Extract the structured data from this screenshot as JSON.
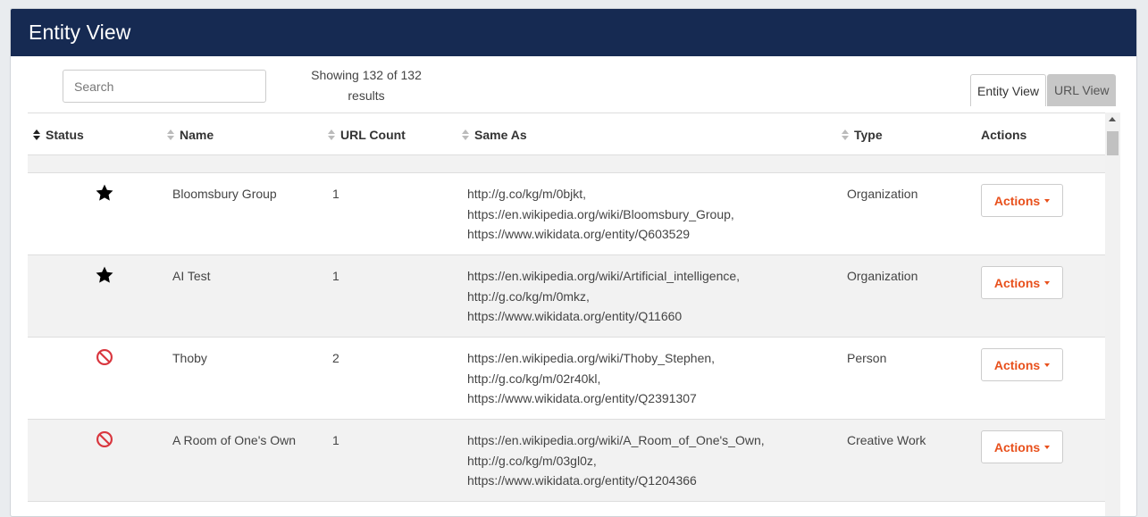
{
  "header": {
    "title": "Entity View"
  },
  "search": {
    "placeholder": "Search",
    "value": ""
  },
  "results": {
    "line1": "Showing 132 of 132",
    "line2": "results"
  },
  "view_toggle": {
    "entity_label": "Entity View",
    "url_label": "URL View"
  },
  "columns": {
    "status": "Status",
    "name": "Name",
    "url_count": "URL Count",
    "same_as": "Same As",
    "type": "Type",
    "actions": "Actions"
  },
  "rows": [
    {
      "status_icon": "star-icon",
      "name": "Bloomsbury Group",
      "url_count": "1",
      "same_as": [
        "http://g.co/kg/m/0bjkt,",
        "https://en.wikipedia.org/wiki/Bloomsbury_Group,",
        "https://www.wikidata.org/entity/Q603529"
      ],
      "type": "Organization",
      "action_label": "Actions"
    },
    {
      "status_icon": "star-icon",
      "name": "AI Test",
      "url_count": "1",
      "same_as": [
        "https://en.wikipedia.org/wiki/Artificial_intelligence,",
        "http://g.co/kg/m/0mkz,",
        "https://www.wikidata.org/entity/Q11660"
      ],
      "type": "Organization",
      "action_label": "Actions"
    },
    {
      "status_icon": "blocked-icon",
      "name": "Thoby",
      "url_count": "2",
      "same_as": [
        "https://en.wikipedia.org/wiki/Thoby_Stephen,",
        "http://g.co/kg/m/02r40kl,",
        "https://www.wikidata.org/entity/Q2391307"
      ],
      "type": "Person",
      "action_label": "Actions"
    },
    {
      "status_icon": "blocked-icon",
      "name": "A Room of One's Own",
      "url_count": "1",
      "same_as": [
        "https://en.wikipedia.org/wiki/A_Room_of_One's_Own,",
        "http://g.co/kg/m/03gl0z,",
        "https://www.wikidata.org/entity/Q1204366"
      ],
      "type": "Creative Work",
      "action_label": "Actions"
    }
  ],
  "colors": {
    "header_bg": "#162a52",
    "accent": "#e8501c",
    "blocked": "#d9363e"
  }
}
